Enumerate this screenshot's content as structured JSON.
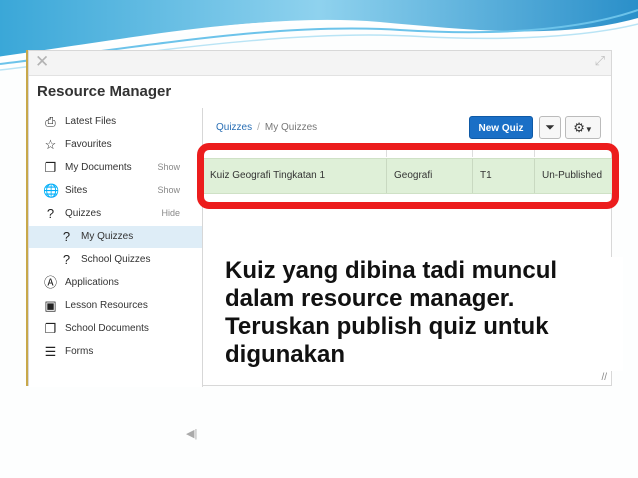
{
  "window": {
    "title": "Resource Manager"
  },
  "sidebar": {
    "items": [
      {
        "label": "Latest Files",
        "action": "",
        "icon": "printer-icon"
      },
      {
        "label": "Favourites",
        "action": "",
        "icon": "star-icon"
      },
      {
        "label": "My Documents",
        "action": "Show",
        "icon": "documents-icon"
      },
      {
        "label": "Sites",
        "action": "Show",
        "icon": "globe-icon"
      },
      {
        "label": "Quizzes",
        "action": "Hide",
        "icon": "quiz-icon"
      },
      {
        "label": "My Quizzes",
        "action": "",
        "icon": "quiz-icon"
      },
      {
        "label": "School Quizzes",
        "action": "",
        "icon": "quiz-icon"
      },
      {
        "label": "Applications",
        "action": "",
        "icon": "apps-icon"
      },
      {
        "label": "Lesson Resources",
        "action": "",
        "icon": "briefcase-icon"
      },
      {
        "label": "School Documents",
        "action": "",
        "icon": "documents-icon"
      },
      {
        "label": "Forms",
        "action": "",
        "icon": "list-icon"
      }
    ]
  },
  "breadcrumb": {
    "root": "Quizzes",
    "current": "My Quizzes"
  },
  "toolbar": {
    "new_quiz_label": "New Quiz"
  },
  "table": {
    "row": {
      "name": "Kuiz Geografi Tingkatan 1",
      "subject": "Geografi",
      "form": "T1",
      "status": "Un-Published"
    }
  },
  "caption": "Kuiz yang dibina tadi muncul dalam resource manager. Teruskan publish quiz untuk digunakan",
  "colors": {
    "highlight": "#ec1d1d",
    "primary_button": "#1a6fc6",
    "selected_row": "#dff0d8",
    "active_sidebar": "#deedf7"
  }
}
